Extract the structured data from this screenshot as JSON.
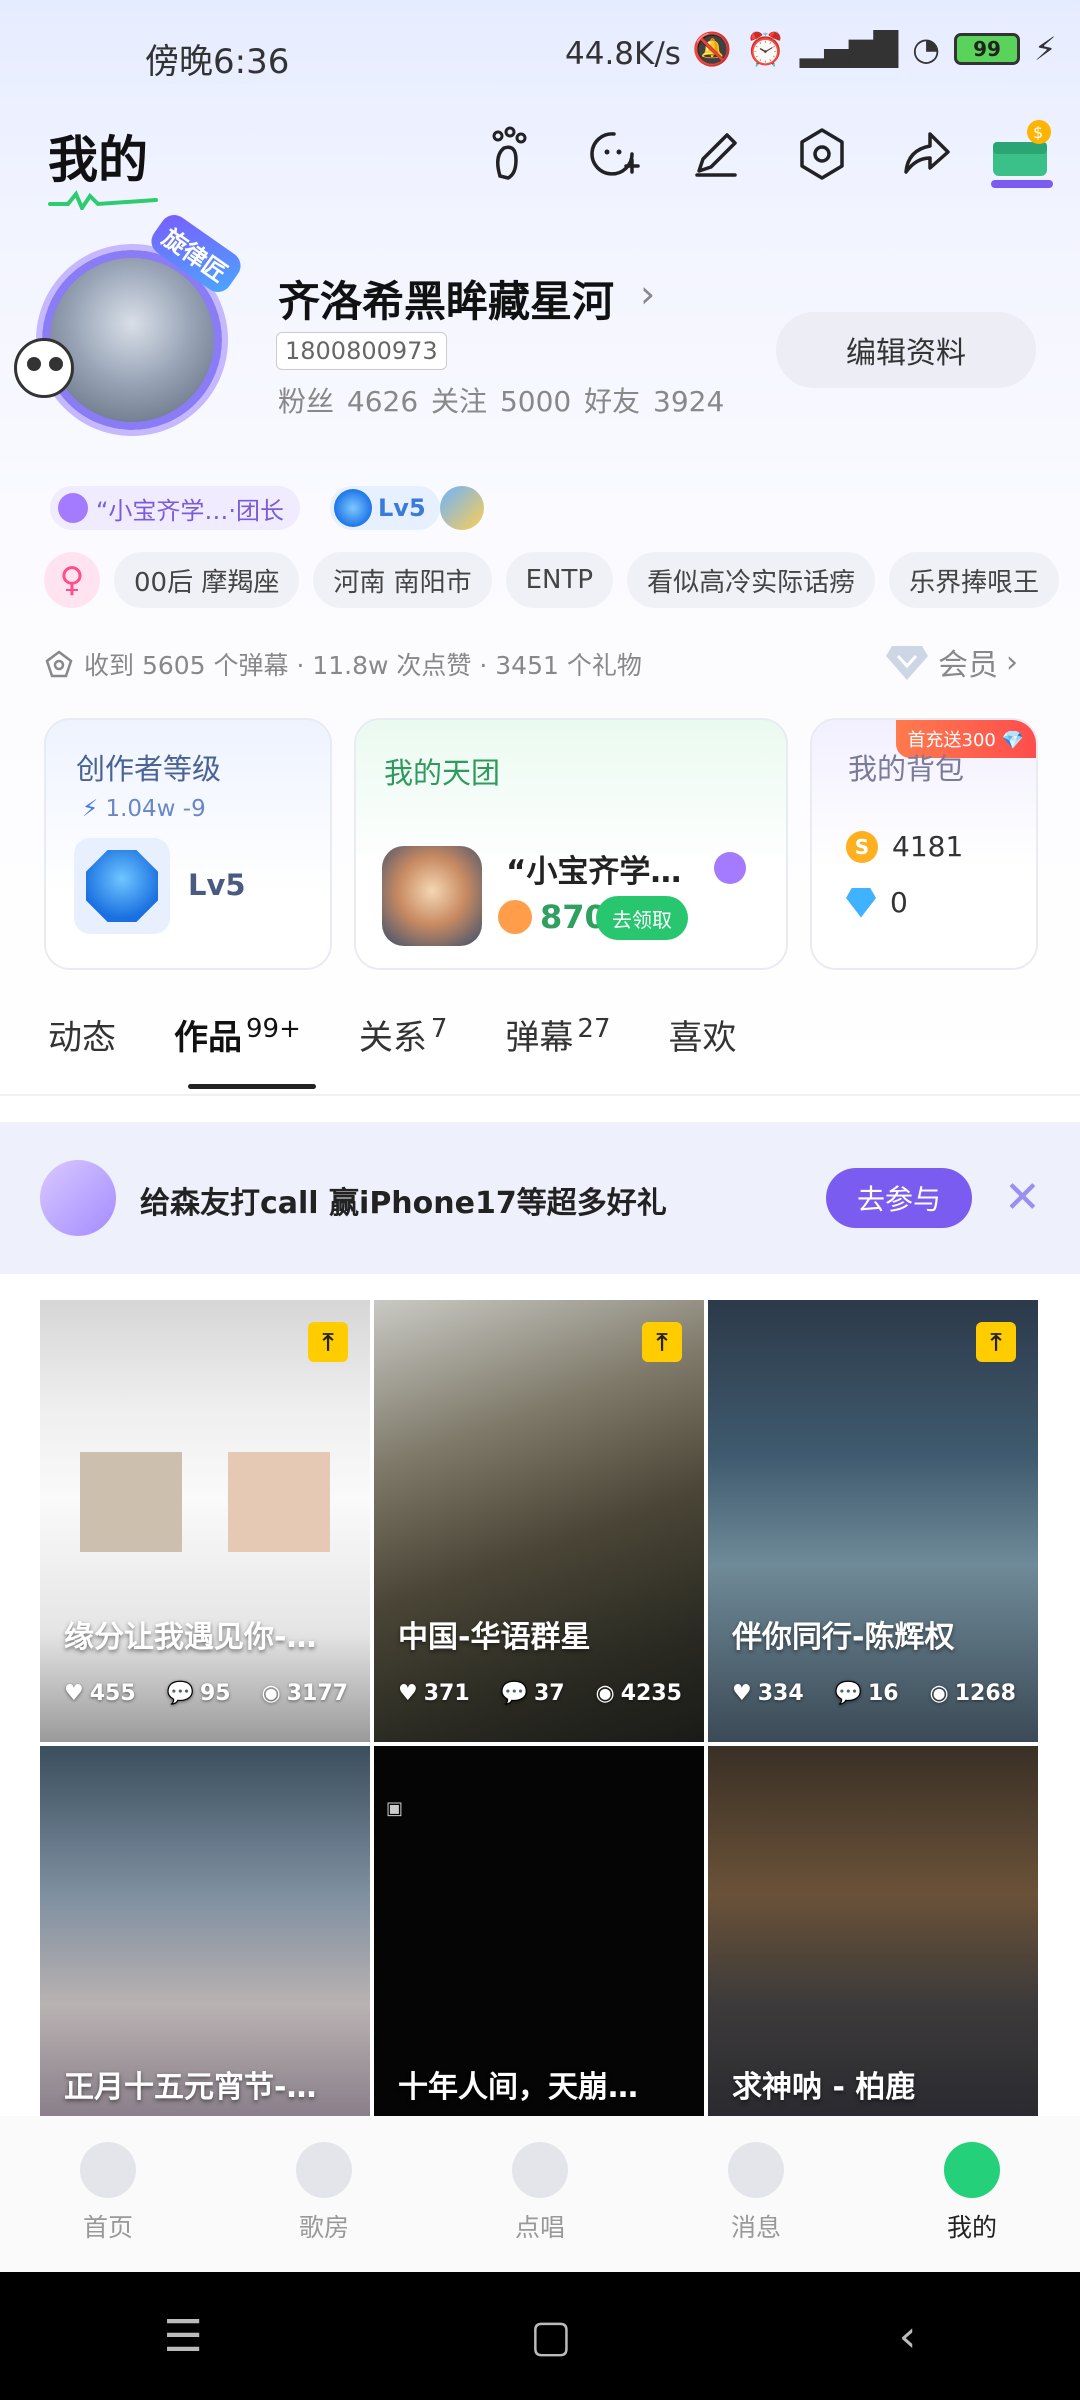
{
  "status_bar": {
    "time": "傍晚6:36",
    "network_speed": "44.8K/s",
    "battery": "99"
  },
  "header": {
    "title": "我的"
  },
  "profile": {
    "avatar_badge": "旋律匠",
    "username": "齐洛希黑眸藏星河",
    "arrow": "›",
    "user_id": "1800800973",
    "stats": "粉丝 4626  关注 5000  好友 3924",
    "edit_button": "编辑资料"
  },
  "badges": {
    "group_label": "“小宝齐学…·团长",
    "level": "Lv5"
  },
  "tags": [
    "00后 摩羯座",
    "河南 南阳市",
    "ENTP",
    "看似高冷实际话痨",
    "乐界捧哏王"
  ],
  "gender_symbol": "♀",
  "received": "收到 5605 个弹幕 · 11.8w 次点赞 · 3451 个礼物",
  "vip": {
    "label": "会员",
    "arrow": "›"
  },
  "cards": {
    "creator": {
      "title": "创作者等级",
      "sub": "1.04w  -9",
      "level": "Lv5"
    },
    "group": {
      "title": "我的天团",
      "name": "“小宝齐学…",
      "points": "870",
      "claim_button": "去领取"
    },
    "bag": {
      "title": "我的背包",
      "badge": "首充送300",
      "coins": "4181",
      "diamonds": "0"
    }
  },
  "tabs": [
    {
      "label": "动态",
      "count": ""
    },
    {
      "label": "作品",
      "count": "99+"
    },
    {
      "label": "关系",
      "count": "7"
    },
    {
      "label": "弹幕",
      "count": "27"
    },
    {
      "label": "喜欢",
      "count": ""
    }
  ],
  "banner": {
    "text": "给森友打call 赢iPhone17等超多好礼",
    "button": "去参与"
  },
  "works": [
    {
      "title": "缘分让我遇见你-…",
      "likes": "455",
      "comments": "95",
      "views": "3177"
    },
    {
      "title": "中国-华语群星",
      "likes": "371",
      "comments": "37",
      "views": "4235"
    },
    {
      "title": "伴你同行-陈辉权",
      "likes": "334",
      "comments": "16",
      "views": "1268"
    },
    {
      "title": "正月十五元宵节-…"
    },
    {
      "title": "十年人间，天崩…"
    },
    {
      "title": "求神呐 - 柏鹿"
    }
  ],
  "bottom_nav": [
    {
      "label": "首页"
    },
    {
      "label": "歌房"
    },
    {
      "label": "点唱"
    },
    {
      "label": "消息"
    },
    {
      "label": "我的"
    }
  ],
  "colors": {
    "accent_purple": "#7a5cf0",
    "accent_green": "#28c76f",
    "tag_bg": "#f0f1f6"
  }
}
